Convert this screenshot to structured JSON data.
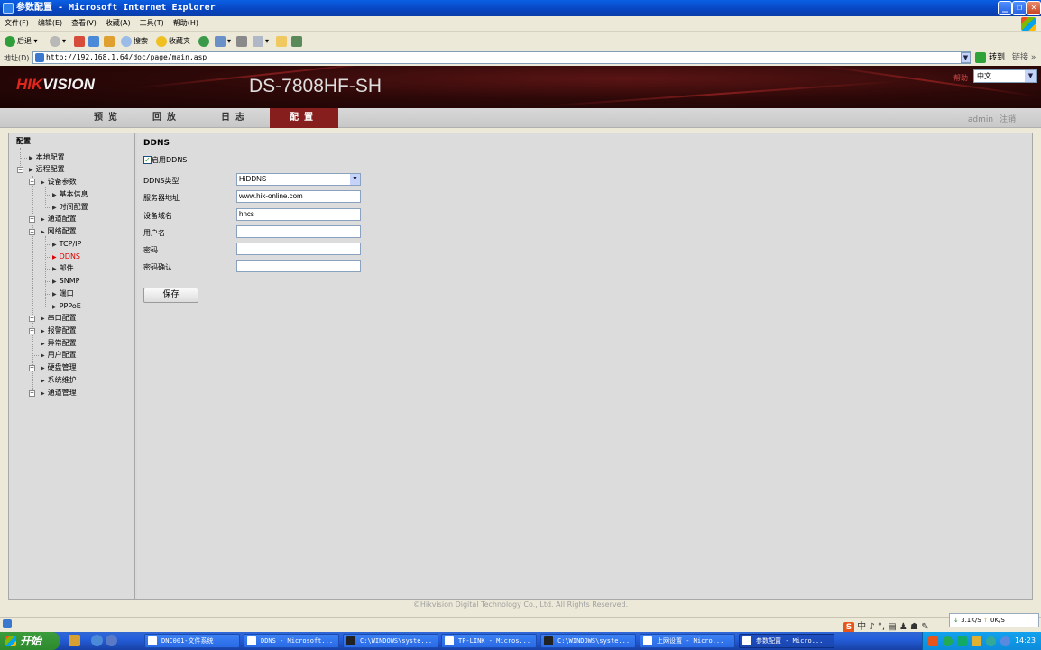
{
  "window": {
    "title": "参数配置 - Microsoft Internet Explorer"
  },
  "menu": [
    "文件(F)",
    "编辑(E)",
    "查看(V)",
    "收藏(A)",
    "工具(T)",
    "帮助(H)"
  ],
  "toolbar": {
    "back": "后退",
    "search": "搜索",
    "favorites": "收藏夹"
  },
  "address": {
    "label": "地址(D)",
    "url": "http://192.168.1.64/doc/page/main.asp",
    "go": "转到",
    "links": "链接"
  },
  "header": {
    "logo_red": "HIK",
    "logo_white": "VISION",
    "model": "DS-7808HF-SH",
    "help": "帮助",
    "language": "中文"
  },
  "nav": {
    "tabs": [
      "预览",
      "回放",
      "日志",
      "配置"
    ],
    "active_tab": "配置",
    "user": "admin",
    "logout": "注销"
  },
  "tree": {
    "root": "配置",
    "items": [
      {
        "label": "本地配置"
      },
      {
        "label": "远程配置"
      },
      {
        "label": "设备参数"
      },
      {
        "label": "基本信息"
      },
      {
        "label": "时间配置"
      },
      {
        "label": "通道配置"
      },
      {
        "label": "网络配置"
      },
      {
        "label": "TCP/IP"
      },
      {
        "label": "DDNS"
      },
      {
        "label": "邮件"
      },
      {
        "label": "SNMP"
      },
      {
        "label": "端口"
      },
      {
        "label": "PPPoE"
      },
      {
        "label": "串口配置"
      },
      {
        "label": "报警配置"
      },
      {
        "label": "异常配置"
      },
      {
        "label": "用户配置"
      },
      {
        "label": "硬盘管理"
      },
      {
        "label": "系统维护"
      },
      {
        "label": "通道管理"
      }
    ],
    "active_item": "DDNS"
  },
  "form": {
    "section_title": "DDNS",
    "enable_label": "启用DDNS",
    "enable_checked": true,
    "fields": [
      {
        "label": "DDNS类型",
        "value": "HiDDNS"
      },
      {
        "label": "服务器地址",
        "value": "www.hik-online.com"
      },
      {
        "label": "设备域名",
        "value": "hncs"
      },
      {
        "label": "用户名",
        "value": ""
      },
      {
        "label": "密码",
        "value": ""
      },
      {
        "label": "密码确认",
        "value": ""
      }
    ],
    "save": "保存"
  },
  "footer": "©Hikvision Digital Technology Co., Ltd. All Rights Reserved.",
  "statusbar": {
    "netspeed_down": "3.1K/S",
    "netspeed_up": "0K/S"
  },
  "taskbar": {
    "start": "开始",
    "tasks": [
      "DNC001-文件系统",
      "DDNS - Microsoft...",
      "C:\\WINDOWS\\syste...",
      "TP-LINK - Micros...",
      "C:\\WINDOWS\\syste...",
      "上网设置 - Micro...",
      "参数配置 - Micro..."
    ],
    "active_task": 6,
    "clock": "14:23"
  },
  "colors": {
    "accent": "#861e1e",
    "active_tree": "#dd0000",
    "logo_red": "#e1261c"
  }
}
